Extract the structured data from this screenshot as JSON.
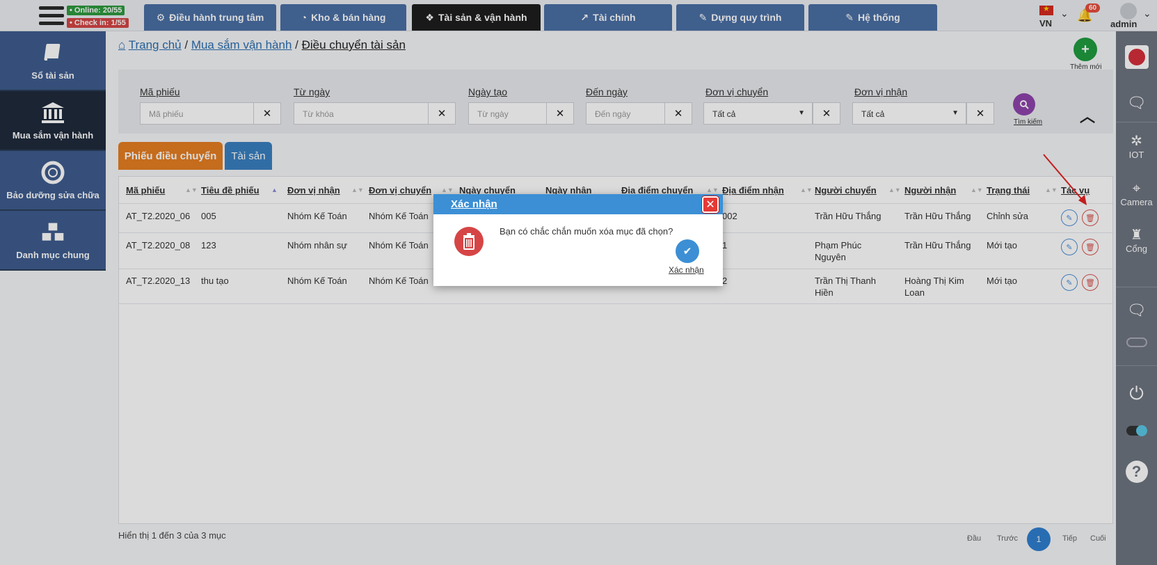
{
  "topbar": {
    "online_badge": "• Online: 20/55",
    "checkin_badge": "• Check in: 1/55",
    "tabs": [
      {
        "label": "Điều hành trung tâm",
        "icon": "gear-icon"
      },
      {
        "label": "Kho & bán hàng",
        "icon": "pie-chart-icon"
      },
      {
        "label": "Tài sản & vận hành",
        "icon": "cubes-icon",
        "active": true
      },
      {
        "label": "Tài chính",
        "icon": "line-chart-icon"
      },
      {
        "label": "Dựng quy trình",
        "icon": "edit-icon"
      },
      {
        "label": "Hệ thống",
        "icon": "edit-icon"
      }
    ],
    "language": "VN",
    "notification_count": "60",
    "user": "admin"
  },
  "sidebar": {
    "items": [
      {
        "label": "Sổ tài sản",
        "icon": "book-icon"
      },
      {
        "label": "Mua sắm vận hành",
        "icon": "bank-icon",
        "active": true
      },
      {
        "label": "Bảo dưỡng sửa chữa",
        "icon": "life-ring-icon"
      },
      {
        "label": "Danh mục chung",
        "icon": "cubes-icon"
      }
    ]
  },
  "rail": {
    "items": [
      {
        "label": "",
        "icon": "app-logo-icon"
      },
      {
        "label": "",
        "icon": "video-chat-icon"
      },
      {
        "label": "IOT",
        "icon": "iot-icon"
      },
      {
        "label": "Camera",
        "icon": "camera-icon"
      },
      {
        "label": "Cổng",
        "icon": "gate-icon"
      },
      {
        "label": "",
        "icon": "video-chat-icon"
      },
      {
        "label": "",
        "icon": "toggle-off-icon"
      },
      {
        "label": "",
        "icon": "plug-icon"
      },
      {
        "label": "",
        "icon": "toggle-on-icon"
      },
      {
        "label": "",
        "icon": "help-icon"
      }
    ]
  },
  "breadcrumb": {
    "home": "Trang chủ",
    "section": "Mua sắm vận hành",
    "current": "Điều chuyển tài sản"
  },
  "add_button": {
    "label": "Thêm mới"
  },
  "filters": {
    "ma_phieu": {
      "label": "Mã phiếu",
      "placeholder": "Mã phiếu"
    },
    "tu_ngay": {
      "label": "Từ ngày",
      "placeholder": "Từ khóa"
    },
    "ngay_tao": {
      "label": "Ngày tạo",
      "placeholder": "Từ ngày"
    },
    "den_ngay": {
      "label": "Đến ngày",
      "placeholder": "Đến ngày"
    },
    "don_vi_chuyen": {
      "label": "Đơn vị chuyển",
      "value": "Tất cả"
    },
    "don_vi_nhan": {
      "label": "Đơn vị nhận",
      "value": "Tất cả"
    },
    "search_label": "Tìm kiếm"
  },
  "tabs": [
    {
      "label": "Phiếu điều chuyển",
      "active": true
    },
    {
      "label": "Tài sản"
    }
  ],
  "table": {
    "headers": [
      "Mã phiếu",
      "Tiêu đề phiếu",
      "Đơn vị nhận",
      "Đơn vị chuyển",
      "Ngày chuyển",
      "Ngày nhận",
      "Địa điểm chuyển",
      "Địa điểm nhận",
      "Người chuyển",
      "Người nhận",
      "Trạng thái",
      "Tác vụ"
    ],
    "rows": [
      [
        "AT_T2.2020_06",
        "005",
        "Nhóm Kế Toán",
        "Nhóm Kế Toán",
        "",
        "",
        "",
        "002",
        "Trần Hữu Thắng",
        "Trần Hữu Thắng",
        "Chỉnh sửa"
      ],
      [
        "AT_T2.2020_08",
        "123",
        "Nhóm nhân sự",
        "Nhóm Kế Toán",
        "",
        "",
        "",
        "1",
        "Phạm Phúc Nguyên",
        "Trần Hữu Thắng",
        "Mới tạo"
      ],
      [
        "AT_T2.2020_13",
        "thu tạo",
        "Nhóm Kế Toán",
        "Nhóm Kế Toán",
        "",
        "",
        "",
        "2",
        "Trần Thị Thanh Hiền",
        "Hoàng Thị Kim Loan",
        "Mới tạo"
      ]
    ]
  },
  "footer": {
    "summary": "Hiển thị 1 đến 3 của 3 mục",
    "first": "Đầu",
    "prev": "Trước",
    "page": "1",
    "next": "Tiếp",
    "last": "Cuối"
  },
  "modal": {
    "title": "Xác nhận",
    "message": "Bạn có chắc chắn muốn xóa mục đã chọn?",
    "confirm_label": "Xác nhận"
  },
  "colors": {
    "nav": "#4a6fa5",
    "active_nav": "#1e1e1e",
    "tab_active": "#e67e22",
    "tab_inactive": "#3a7fc0",
    "modal_header": "#3c8fd4",
    "danger": "#d64545"
  }
}
